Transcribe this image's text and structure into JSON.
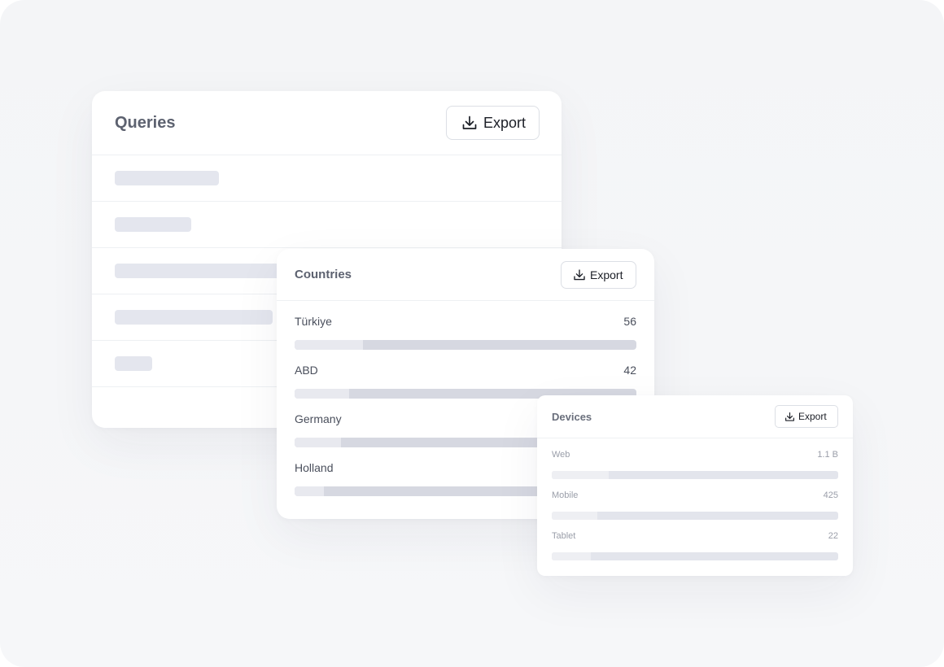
{
  "queries": {
    "title": "Queries",
    "export_label": "Export",
    "export_icon": "download-icon",
    "placeholder_rows": 5
  },
  "countries": {
    "title": "Countries",
    "export_label": "Export",
    "export_icon": "download-icon",
    "items": [
      {
        "label": "Türkiye",
        "value": "56",
        "share": 0.2
      },
      {
        "label": "ABD",
        "value": "42",
        "share": 0.16
      },
      {
        "label": "Germany",
        "value": "",
        "share": 0.135
      },
      {
        "label": "Holland",
        "value": "",
        "share": 0.085
      }
    ]
  },
  "devices": {
    "title": "Devices",
    "export_label": "Export",
    "export_icon": "download-icon",
    "items": [
      {
        "label": "Web",
        "value": "1.1 B",
        "share": 0.2
      },
      {
        "label": "Mobile",
        "value": "425",
        "share": 0.16
      },
      {
        "label": "Tablet",
        "value": "22",
        "share": 0.135
      }
    ]
  },
  "colors": {
    "background": "#f4f5f7",
    "card": "#ffffff",
    "skeleton": "#e4e6ee",
    "bar_track": "#d6d8e1",
    "bar_fill": "#e8e9ef",
    "title_text": "#5d6270"
  }
}
